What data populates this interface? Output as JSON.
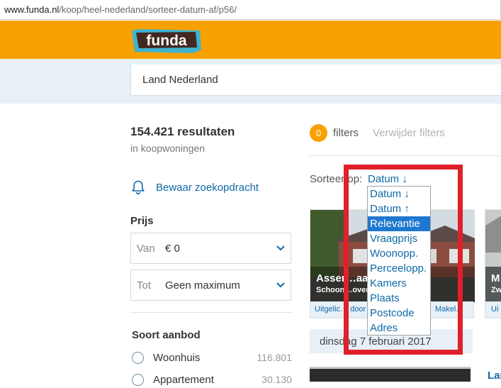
{
  "browser": {
    "url_domain": "www.funda.nl",
    "url_path": "/koop/heel-nederland/sorteer-datum-af/p56/"
  },
  "header": {
    "logo_text": "funda"
  },
  "search": {
    "value": "Land Nederland"
  },
  "results": {
    "count": "154.421 resultaten",
    "subtitle": "in koopwoningen"
  },
  "save_search": {
    "label": "Bewaar zoekopdracht",
    "icon": "bell-icon"
  },
  "price": {
    "title": "Prijs",
    "from": {
      "prefix": "Van",
      "value": "€ 0"
    },
    "to": {
      "prefix": "Tot",
      "value": "Geen maximum"
    }
  },
  "offer_type": {
    "title": "Soort aanbod",
    "options": [
      {
        "label": "Woonhuis",
        "count": "116.801"
      },
      {
        "label": "Appartement",
        "count": "30.130"
      }
    ]
  },
  "filters": {
    "count": "0",
    "label": "filters",
    "remove": "Verwijder filters"
  },
  "sort": {
    "label": "Sorteer op:",
    "current": "Datum ↓",
    "options": [
      "Datum ↓",
      "Datum ↑",
      "Relevantie",
      "Vraagprijs",
      "Woonopp.",
      "Perceelopp.",
      "Kamers",
      "Plaats",
      "Postcode",
      "Adres"
    ],
    "highlighted": "Relevantie"
  },
  "listings": [
    {
      "address": "Asser…aan",
      "city": "Schoon…oven",
      "footer_left": "Uitgelic… door",
      "footer_right": "Makel…"
    },
    {
      "address": "M",
      "city": "Zw",
      "footer_left": "Ui",
      "footer_right": ""
    }
  ],
  "date_band": "dinsdag 7 februari 2017",
  "next_listing_title": "Lar",
  "colors": {
    "brand_orange": "#f7a100",
    "link_blue": "#0e6aa8",
    "highlight_blue": "#1e77d0",
    "annotation_red": "#e0202b"
  }
}
